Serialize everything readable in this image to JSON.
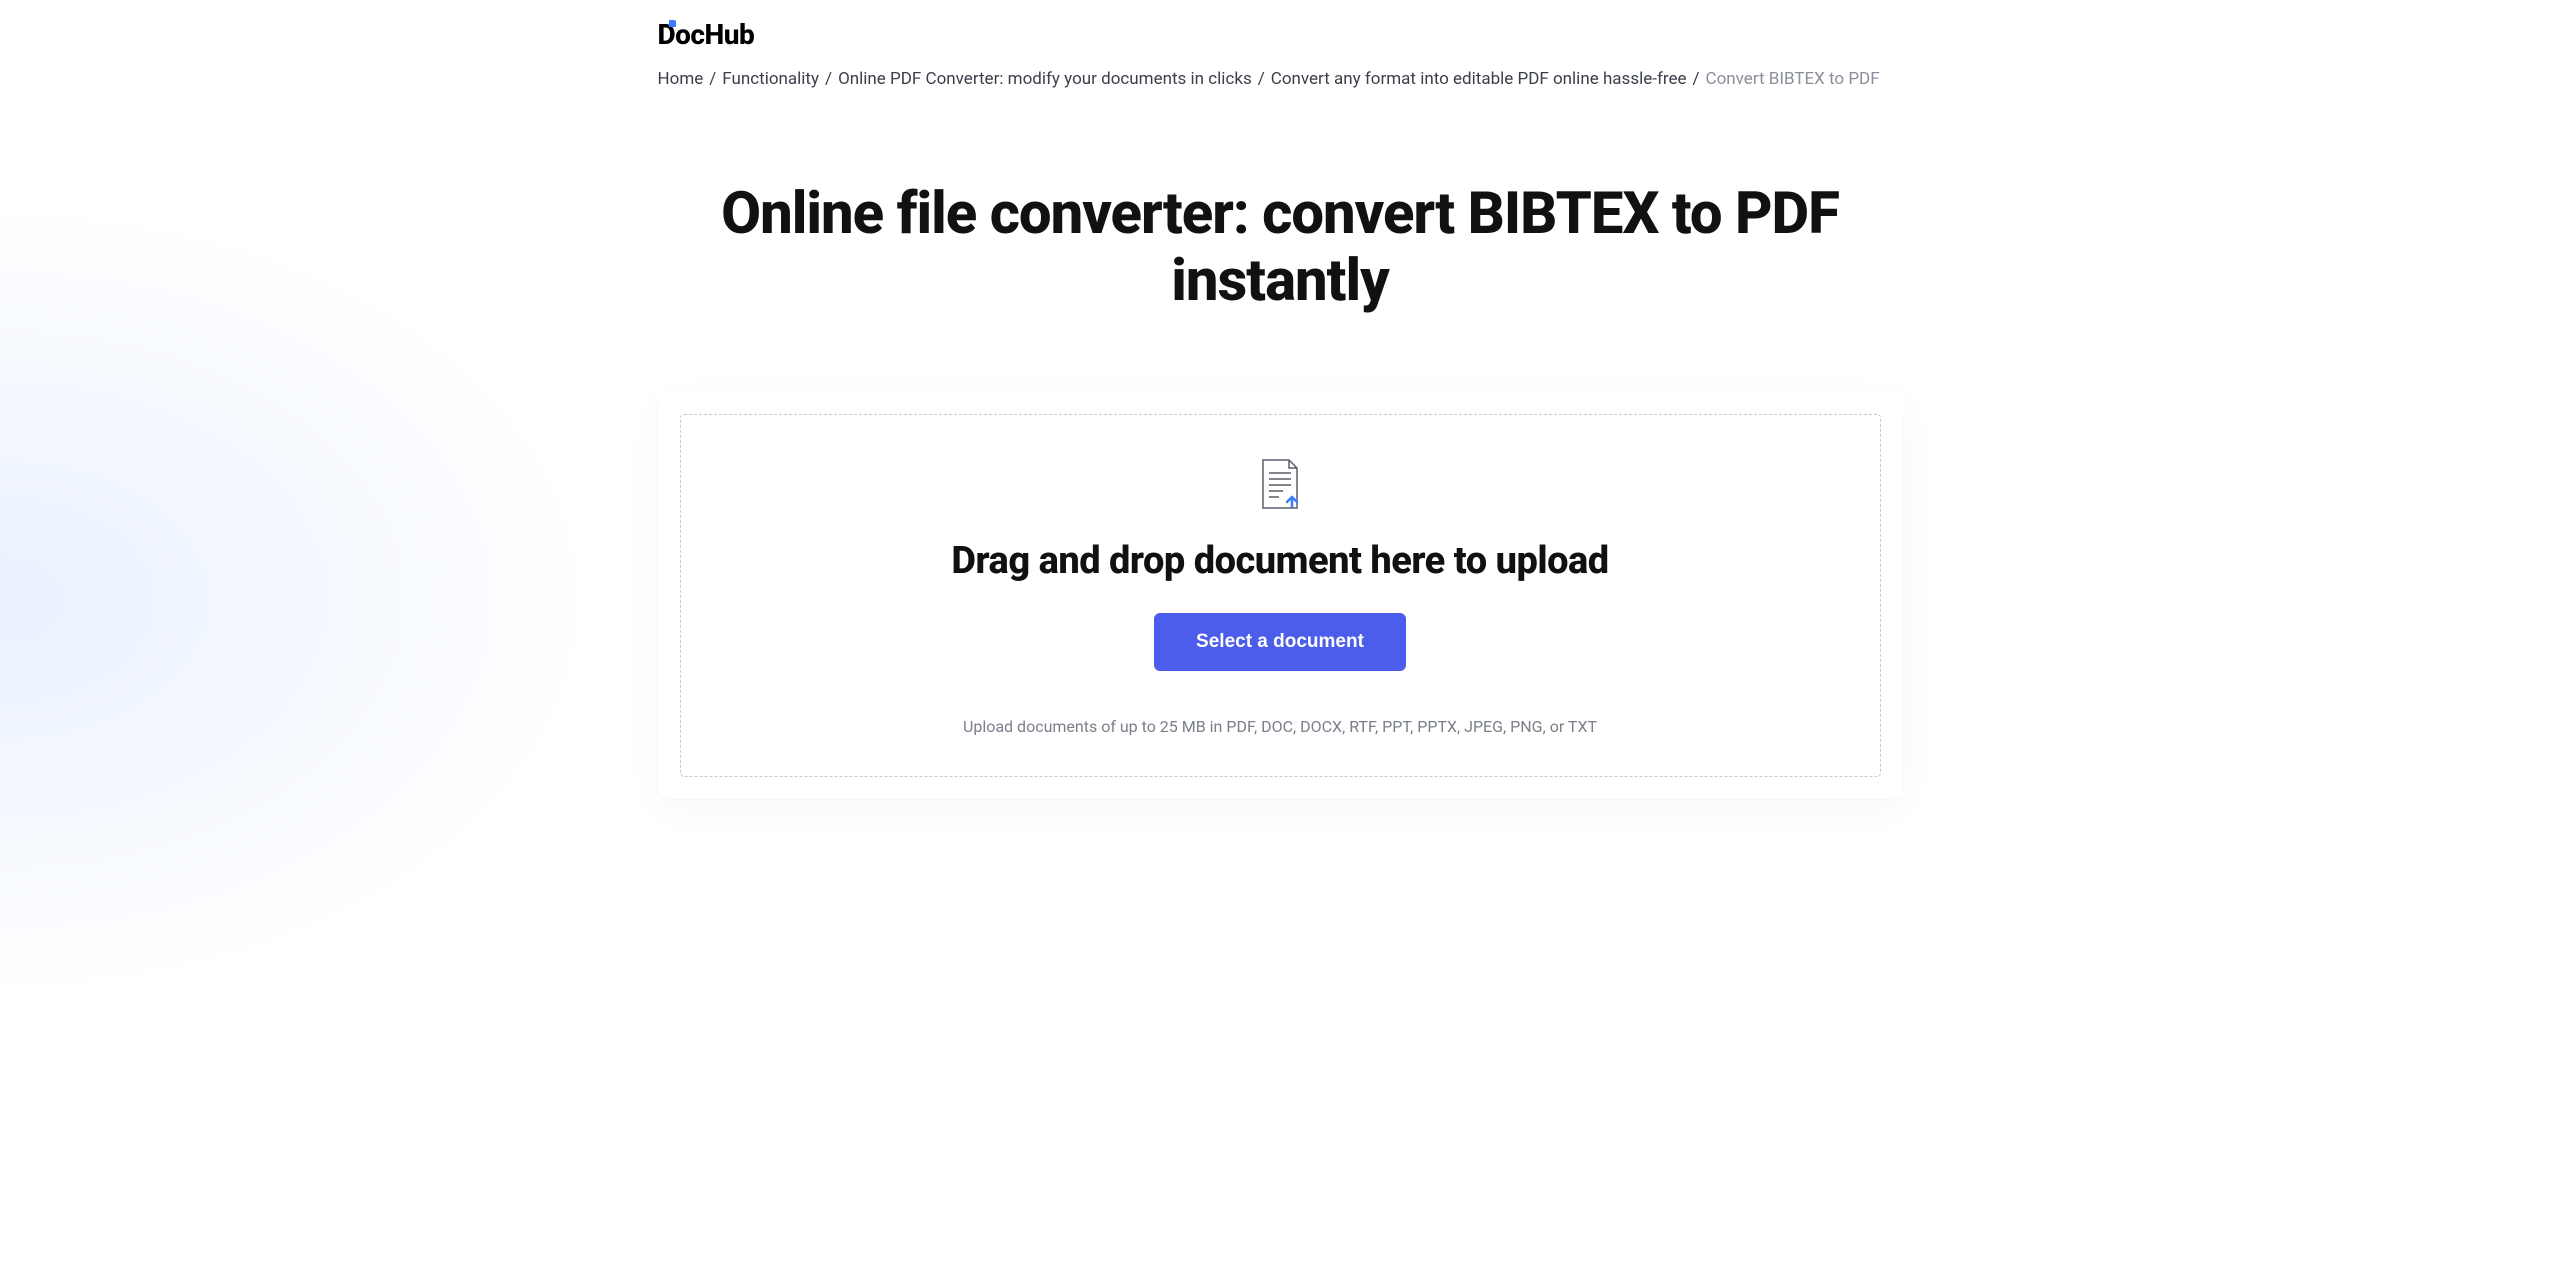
{
  "logo": {
    "text": "DocHub"
  },
  "breadcrumb": {
    "items": [
      {
        "label": "Home",
        "link": true
      },
      {
        "label": "Functionality",
        "link": true
      },
      {
        "label": "Online PDF Converter: modify your documents in clicks",
        "link": true
      },
      {
        "label": "Convert any format into editable PDF online hassle-free",
        "link": true
      },
      {
        "label": "Convert BIBTEX to PDF",
        "link": false
      }
    ],
    "separator": "/"
  },
  "page": {
    "title": "Online file converter: convert BIBTEX to PDF instantly"
  },
  "dropzone": {
    "title": "Drag and drop document here to upload",
    "button_label": "Select a document",
    "hint": "Upload documents of up to 25 MB in PDF, DOC, DOCX, RTF, PPT, PPTX, JPEG, PNG, or TXT"
  }
}
